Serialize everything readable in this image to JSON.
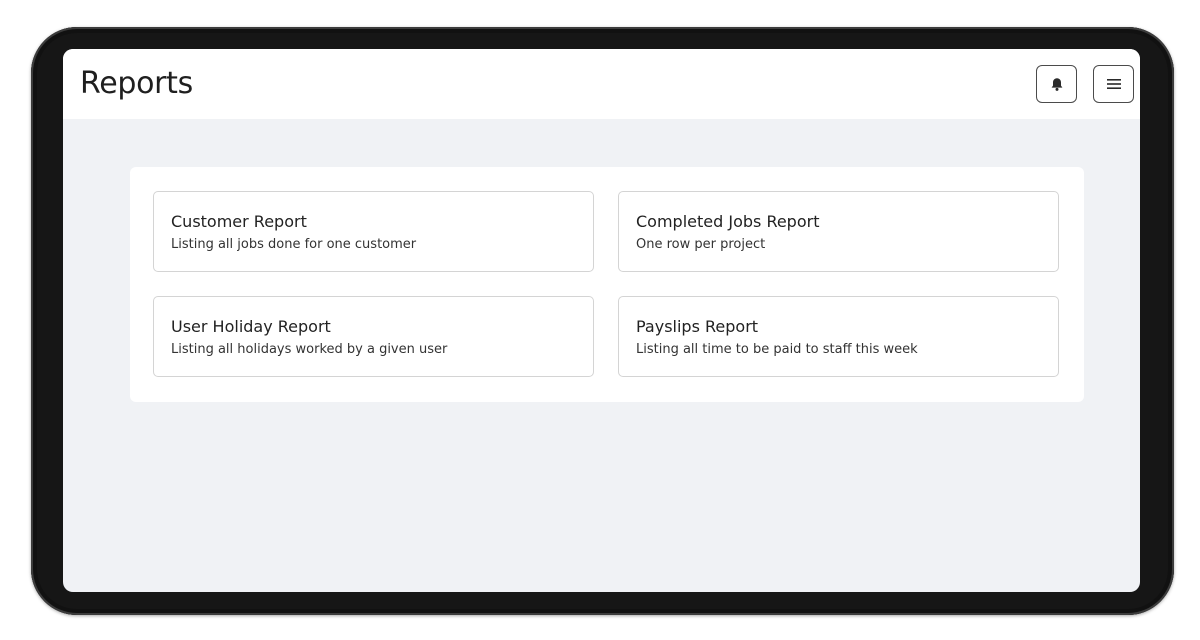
{
  "header": {
    "title": "Reports",
    "notifications_icon": "bell-icon",
    "menu_icon": "hamburger-menu-icon"
  },
  "reports": [
    {
      "title": "Customer Report",
      "description": "Listing all jobs done for one customer"
    },
    {
      "title": "Completed Jobs Report",
      "description": "One row per project"
    },
    {
      "title": "User Holiday Report",
      "description": "Listing all holidays worked by a given user"
    },
    {
      "title": "Payslips Report",
      "description": "Listing all time to be paid to staff this week"
    }
  ]
}
